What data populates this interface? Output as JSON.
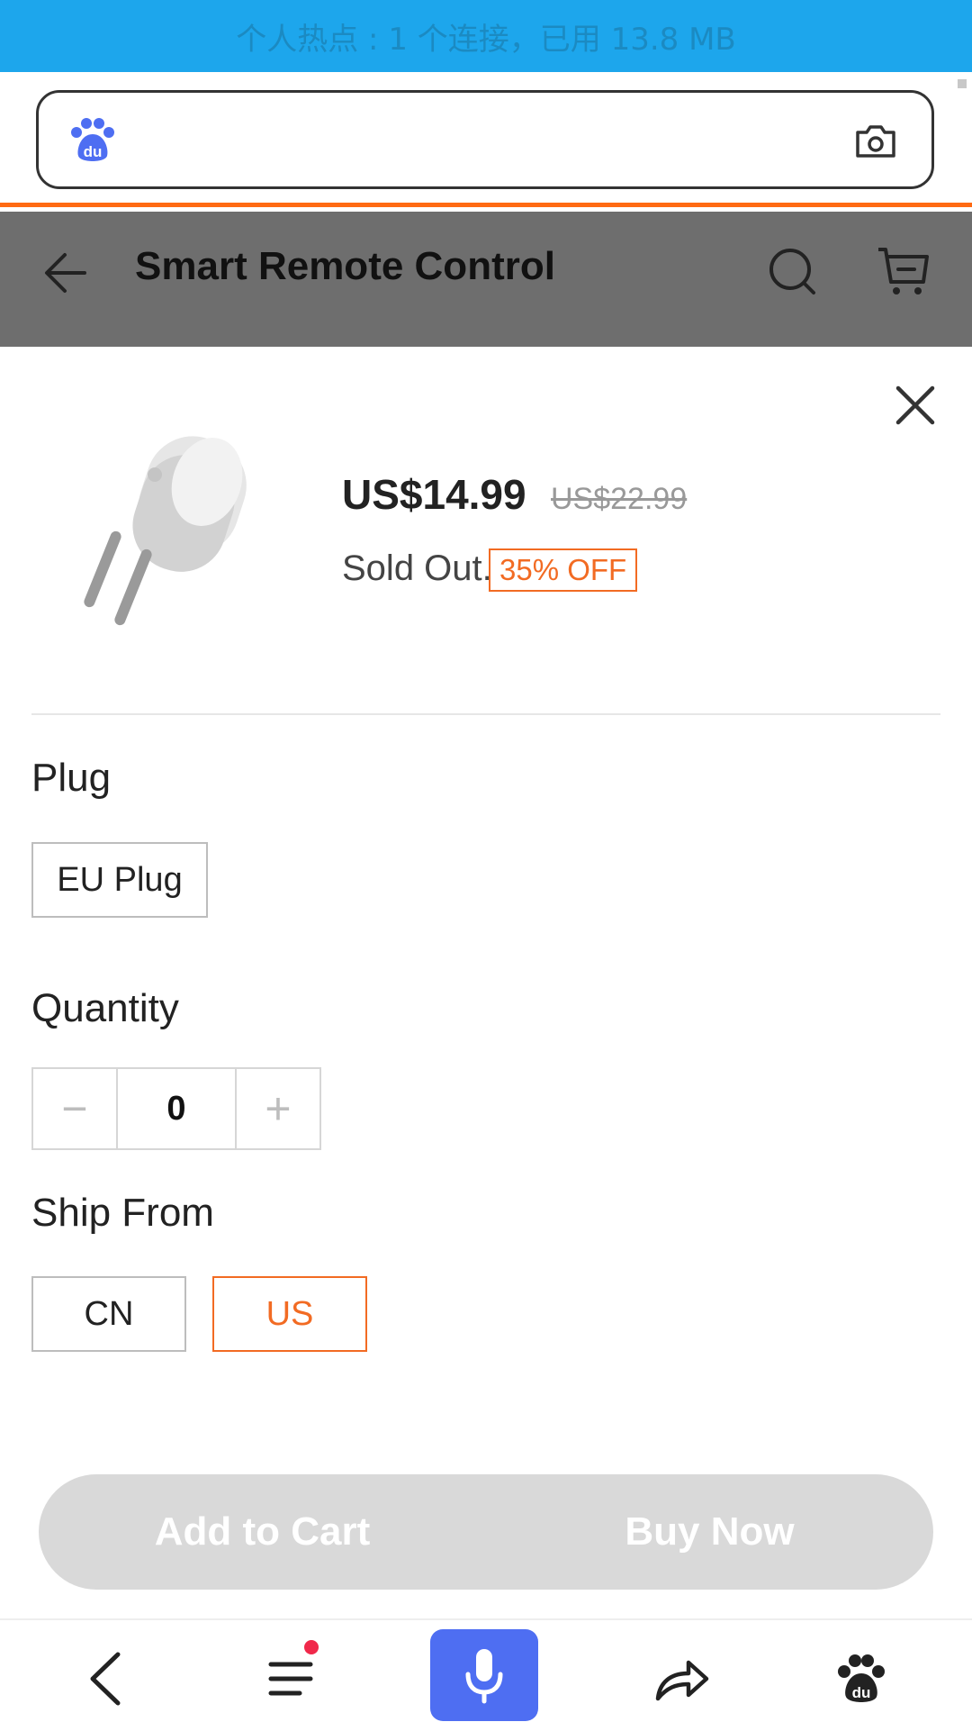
{
  "status_bar": {
    "text": "个人热点 : 1 个连接，已用 13.8 MB"
  },
  "browser": {
    "search_value": "",
    "logo_text": "du"
  },
  "header": {
    "title": "Smart Remote Control"
  },
  "product": {
    "price": "US$14.99",
    "original_price": "US$22.99",
    "stock_status": "Sold Out.",
    "discount": "35% OFF"
  },
  "plug": {
    "label": "Plug",
    "options": [
      "EU Plug"
    ],
    "selected": "EU Plug"
  },
  "quantity": {
    "label": "Quantity",
    "value": "0",
    "minus": "−",
    "plus": "+"
  },
  "ship_from": {
    "label": "Ship From",
    "options": [
      "CN",
      "US"
    ],
    "selected": "US"
  },
  "actions": {
    "add_to_cart": "Add to Cart",
    "buy_now": "Buy Now"
  },
  "colors": {
    "accent": "#f26b23",
    "status_bar": "#1da6ec",
    "baidu_blue": "#4e6ef2",
    "disabled": "#d9d9d9"
  },
  "icons": [
    "back-arrow-icon",
    "search-icon",
    "cart-icon",
    "close-icon",
    "camera-icon",
    "menu-icon",
    "microphone-icon",
    "share-icon",
    "baidu-paw-icon"
  ]
}
